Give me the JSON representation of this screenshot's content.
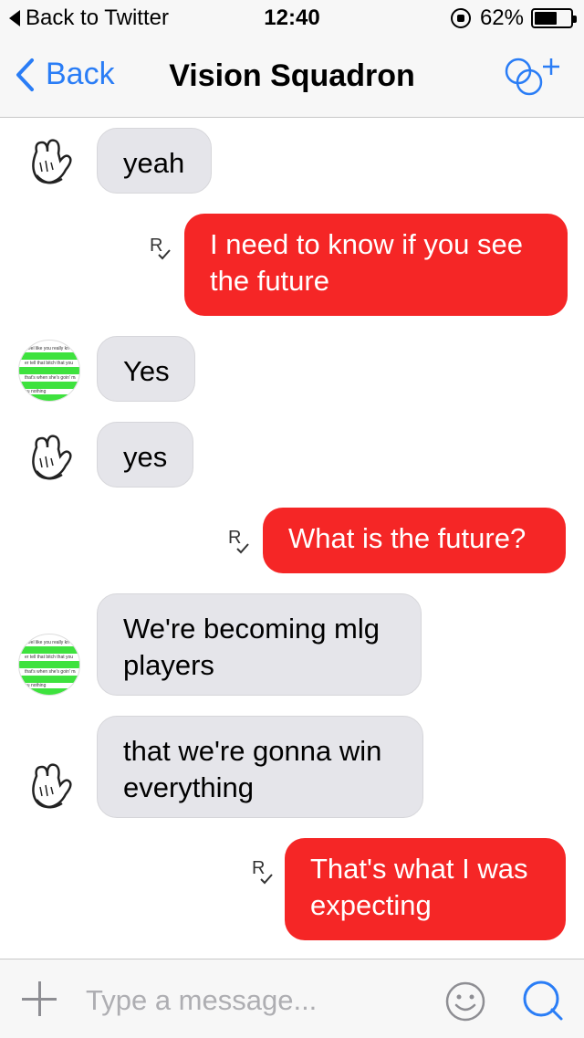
{
  "status_bar": {
    "back_label": "Back to Twitter",
    "time": "12:40",
    "battery_text": "62%",
    "battery_level": 0.62
  },
  "nav": {
    "back_label": "Back",
    "title": "Vision Squadron"
  },
  "messages": [
    {
      "text": "yeah"
    },
    {
      "text": "I need to know if you see the future"
    },
    {
      "text": "Yes"
    },
    {
      "text": "yes"
    },
    {
      "text": "What is the future?"
    },
    {
      "text": "We're becoming mlg players"
    },
    {
      "text": "that we're gonna win everything"
    },
    {
      "text": "That's what I was expecting"
    }
  ],
  "read_marker": "R",
  "composer": {
    "placeholder": "Type a message..."
  },
  "colors": {
    "accent": "#2a7df6",
    "outgoing_bubble": "#f52626",
    "incoming_bubble": "#e5e5ea"
  }
}
